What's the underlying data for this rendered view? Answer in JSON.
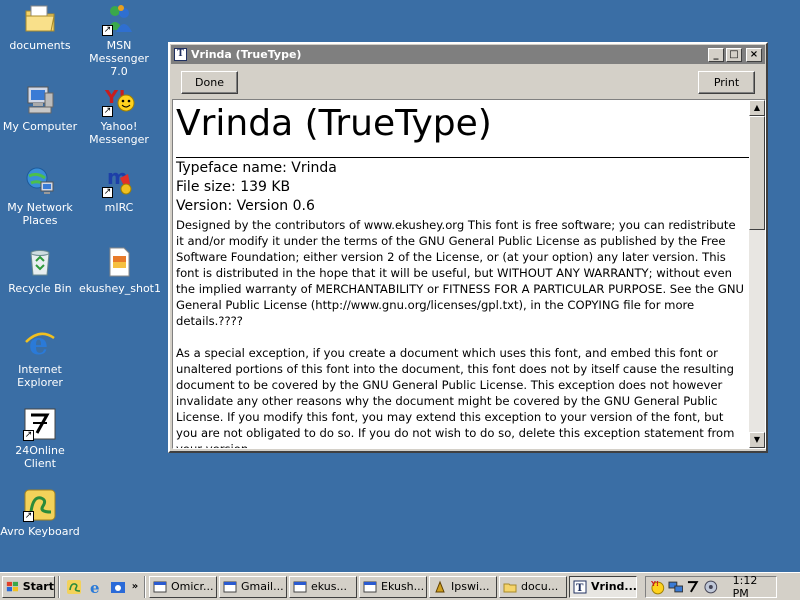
{
  "desktop": {
    "icons": [
      {
        "label": "documents"
      },
      {
        "label": "MSN Messenger 7.0"
      },
      {
        "label": "My Computer"
      },
      {
        "label": "Yahoo! Messenger"
      },
      {
        "label": "My Network Places"
      },
      {
        "label": "mIRC"
      },
      {
        "label": "Recycle Bin"
      },
      {
        "label": "ekushey_shot1"
      },
      {
        "label": "Internet Explorer"
      },
      {
        "label": "24Online Client"
      },
      {
        "label": "Avro Keyboard"
      }
    ]
  },
  "window": {
    "title": "Vrinda (TrueType)",
    "title_icon": "T",
    "buttons": {
      "done": "Done",
      "print": "Print"
    },
    "controls": {
      "minimize": "_",
      "maximize": "□",
      "close": "×"
    },
    "font_title": "Vrinda (TrueType)",
    "typeface_line": "Typeface name: Vrinda",
    "filesize_line": "File size: 139 KB",
    "version_line": "Version: Version 0.6",
    "description": "Designed by the contributors of www.ekushey.org This font is free software; you can redistribute it and/or modify it under the terms of the GNU General Public License as published by the Free Software Foundation; either version 2 of the License, or (at your option) any later version. This font is distributed in the hope that it will be useful, but WITHOUT ANY WARRANTY; without even the implied warranty of MERCHANTABILITY or FITNESS FOR A PARTICULAR PURPOSE. See the GNU General Public License (http://www.gnu.org/licenses/gpl.txt), in the COPYING file for more details.????",
    "exception": "As a special exception, if you create a document which uses this font, and embed this font or unaltered portions of this font into the document, this font does not by itself cause the resulting document to be covered by the GNU General Public License. This exception does not however invalidate any other reasons why the document might be covered by the GNU General Public License. If you modify this font, you may extend this exception to your version of the font, but you are not obligated to do so. If you do not wish to do so, delete this exception statement from your version."
  },
  "taskbar": {
    "start_label": "Start",
    "more_glyph": "»",
    "tasks": [
      {
        "label": "Omicr...",
        "icon": "window-icon"
      },
      {
        "label": "Gmail...",
        "icon": "window-icon"
      },
      {
        "label": "ekus...",
        "icon": "window-icon"
      },
      {
        "label": "Ekush...",
        "icon": "window-icon"
      },
      {
        "label": "Ipswi...",
        "icon": "app-icon"
      },
      {
        "label": "docu...",
        "icon": "folder-icon"
      },
      {
        "label": "Vrind...",
        "icon": "font-icon",
        "active": true
      }
    ],
    "clock": "1:12 PM"
  },
  "colors": {
    "desktop": "#3a6ea5",
    "titlebar_inactive": "#7f7f7f",
    "face": "#d4d0c8"
  }
}
